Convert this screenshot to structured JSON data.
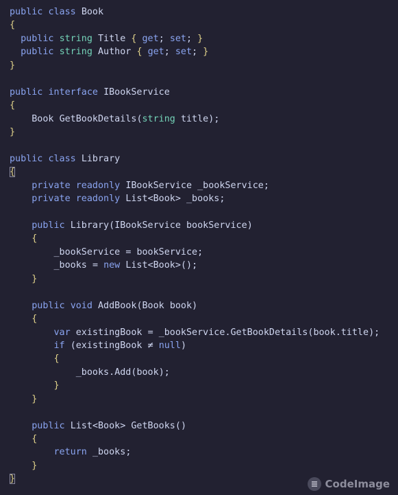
{
  "code_lines": [
    "public class Book",
    "{",
    "  public string Title { get; set; }",
    "  public string Author { get; set; }",
    "}",
    "",
    "public interface IBookService",
    "{",
    "    Book GetBookDetails(string title);",
    "}",
    "",
    "public class Library",
    "{",
    "    private readonly IBookService _bookService;",
    "    private readonly List<Book> _books;",
    "",
    "    public Library(IBookService bookService)",
    "    {",
    "        _bookService = bookService;",
    "        _books = new List<Book>();",
    "    }",
    "",
    "    public void AddBook(Book book)",
    "    {",
    "        var existingBook = _bookService.GetBookDetails(book.title);",
    "        if (existingBook ≠ null)",
    "        {",
    "            _books.Add(book);",
    "        }",
    "    }",
    "",
    "    public List<Book> GetBooks()",
    "    {",
    "        return _books;",
    "    }",
    "}"
  ],
  "watermark": {
    "label": "CodeImage",
    "icon": "codeimage-logo-icon"
  },
  "colors": {
    "background": "#222131",
    "keyword": "#8aa4f0",
    "type": "#74d3b8",
    "identifier": "#cfd6f0",
    "brace": "#e0d28a"
  }
}
